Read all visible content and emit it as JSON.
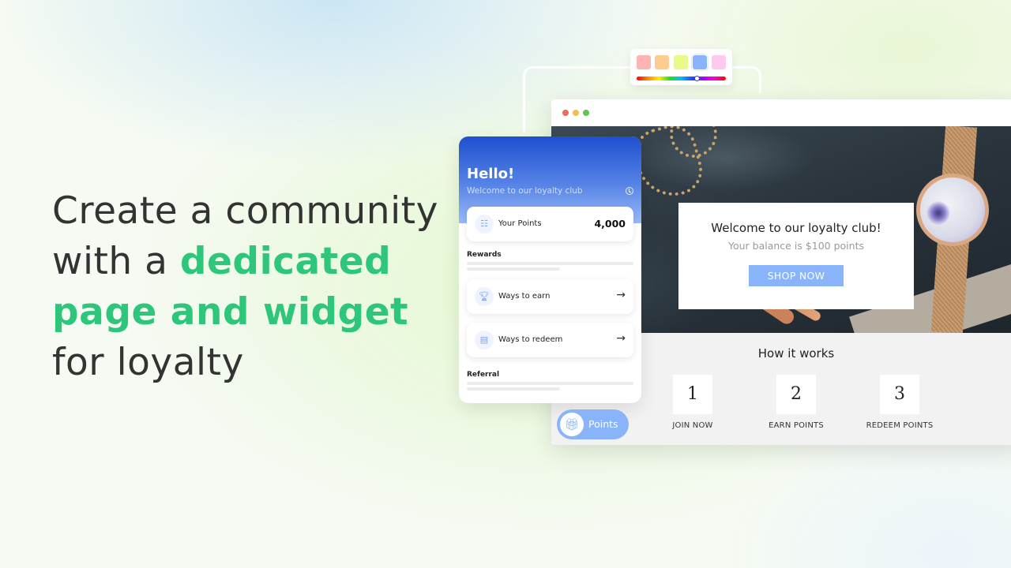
{
  "headline": {
    "part1": "Create a community with a ",
    "accent1": "dedicated page and widget",
    "part2": " for loyalty",
    "accent_color": "#2ec67a"
  },
  "palette": {
    "swatches": [
      "#ffb3b3",
      "#ffcc8f",
      "#e9f98a",
      "#8ab4fa",
      "#ffc8ee"
    ],
    "selected_index": 3,
    "hue_position": 0.67
  },
  "browser": {
    "traffic_lights": [
      "#ec6a5e",
      "#f4bf4f",
      "#61c554"
    ],
    "hero": {
      "title": "Welcome to our loyalty club!",
      "subtitle": "Your balance is $100 points",
      "button_label": "SHOP NOW"
    },
    "how_it_works": {
      "title": "How it works",
      "steps": [
        {
          "number": "1",
          "label": "JOIN NOW"
        },
        {
          "number": "2",
          "label": "EARN POINTS"
        },
        {
          "number": "3",
          "label": "REDEEM POINTS"
        }
      ]
    }
  },
  "widget": {
    "greeting": "Hello!",
    "subtitle": "Welcome to our loyalty club",
    "points_label": "Your Points",
    "points_value": "4,000",
    "rewards_label": "Rewards",
    "earn_label": "Ways to earn",
    "redeem_label": "Ways to redeem",
    "referral_label": "Referral",
    "icons": {
      "history": "history-icon",
      "points": "coins-icon",
      "earn": "trophy-icon",
      "redeem": "coin-stack-icon",
      "arrow": "arrow-right-icon"
    }
  },
  "launcher": {
    "label": "Points",
    "icon": "gift-icon"
  }
}
